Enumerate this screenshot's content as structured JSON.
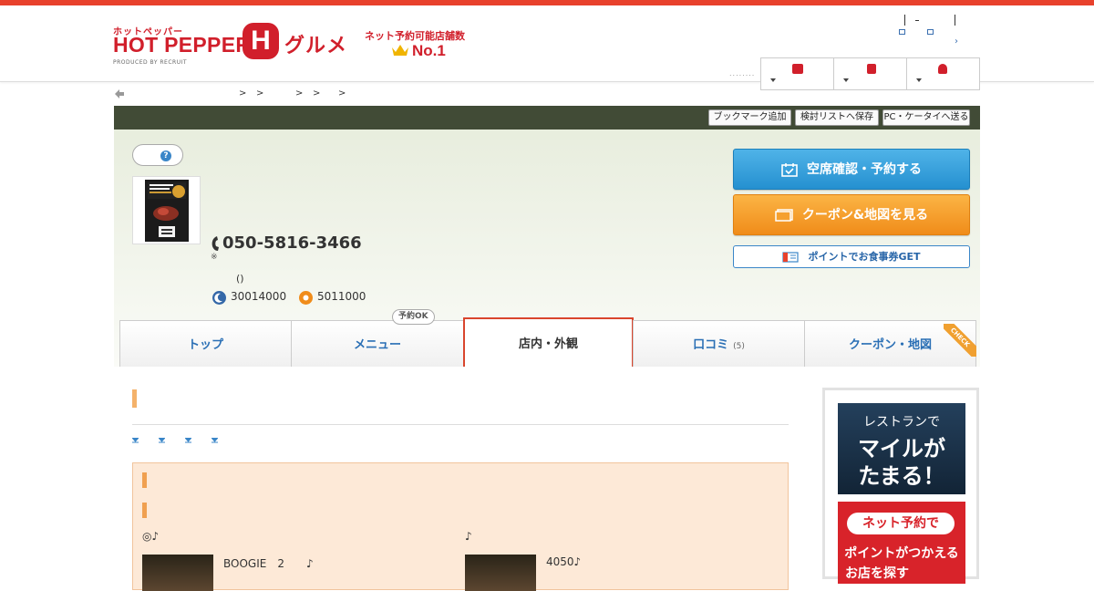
{
  "header": {
    "brand_small": "ホットペッパー",
    "brand_main": "HOT PEPPER",
    "brand_h": "H",
    "brand_gourmet": "グルメ",
    "produced_by": "PRODUCED BY RECRUIT",
    "rank_text": "ネット予約可能店舗数",
    "rank_no1": "No.1",
    "right_arrow": "›",
    "dots": "........"
  },
  "breadcrumb": {
    "separators": [
      ">",
      ">",
      ">",
      ">",
      ">"
    ]
  },
  "shop": {
    "toolbar": {
      "bookmark": "ブックマーク追加",
      "save_list": "検討リストへ保存",
      "send_pc": "PC・ケータイへ送る"
    },
    "help": "?",
    "phone": "050-5816-3466",
    "phone_note": "※",
    "hours_paren": "()",
    "budget_dinner": "30014000",
    "budget_lunch": "5011000",
    "cta": {
      "reserve": "空席確認・予約する",
      "coupon": "クーポン&地図を見る",
      "point": "ポイントでお食事券GET"
    }
  },
  "tabs": [
    {
      "label": "トップ"
    },
    {
      "label": "メニュー"
    },
    {
      "label": "店内・外観"
    },
    {
      "label": "口コミ",
      "count": "(5)"
    },
    {
      "label": "クーポン・地図"
    }
  ],
  "tab_badge": "予約OK",
  "tab_ribbon": "CHECK",
  "main": {
    "col1_title": "◎♪",
    "col2_title": "♪",
    "col1_text": "BOOGIE　2　　♪",
    "col2_text": "4050♪"
  },
  "ads": {
    "mile_l1": "レストランで",
    "mile_l2": "マイルが",
    "mile_l3": "たまる！",
    "net_l1": "ネット予約で",
    "net_l2": "ポイントがつかえる",
    "net_l3": "お店を探す"
  },
  "colors": {
    "brand_red": "#d11f2b",
    "accent_green": "#414b36",
    "reserve_blue": "#2590d0",
    "coupon_orange": "#f08c1a"
  }
}
